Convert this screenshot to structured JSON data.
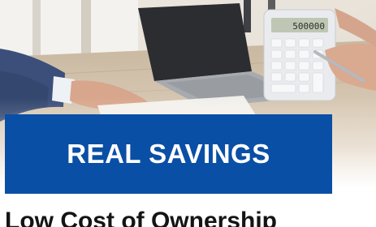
{
  "promo": {
    "banner_title": "REAL SAVINGS",
    "headline": "Low Cost of Ownership",
    "calculator_display": "500000"
  },
  "colors": {
    "banner_blue": "#0a4fa6",
    "headline_text": "#141414"
  },
  "image": {
    "scene": "hands-with-calculator-and-laptop-photo"
  }
}
